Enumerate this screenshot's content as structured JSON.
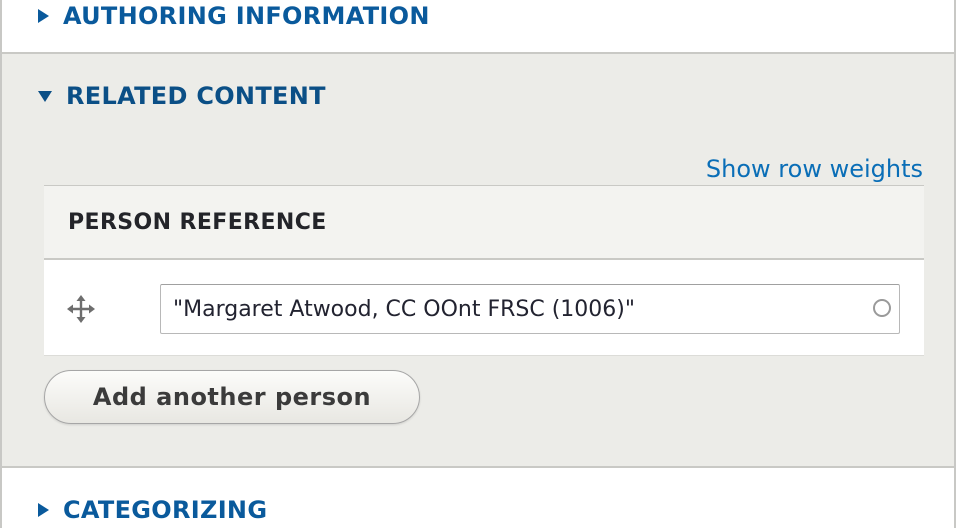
{
  "sections": {
    "authoring": {
      "label": "AUTHORING INFORMATION",
      "state": "collapsed"
    },
    "related": {
      "label": "RELATED CONTENT",
      "state": "expanded"
    },
    "categorizing": {
      "label": "CATEGORIZING",
      "state": "collapsed"
    }
  },
  "related_content": {
    "show_row_weights_label": "Show row weights",
    "table": {
      "header": "PERSON REFERENCE",
      "rows": [
        {
          "value": "\"Margaret Atwood, CC OOnt FRSC (1006)\""
        }
      ]
    },
    "add_button_label": "Add another person"
  },
  "icons": {
    "collapsed": "triangle-right-icon",
    "expanded": "triangle-down-icon",
    "drag": "drag-handle-icon",
    "autocomplete": "autocomplete-throbber-icon"
  },
  "colors": {
    "link": "#0a6eb7",
    "summary_text": "#0a5a9c",
    "expanded_bg": "#ecece8",
    "header_bg": "#f3f3f0"
  }
}
